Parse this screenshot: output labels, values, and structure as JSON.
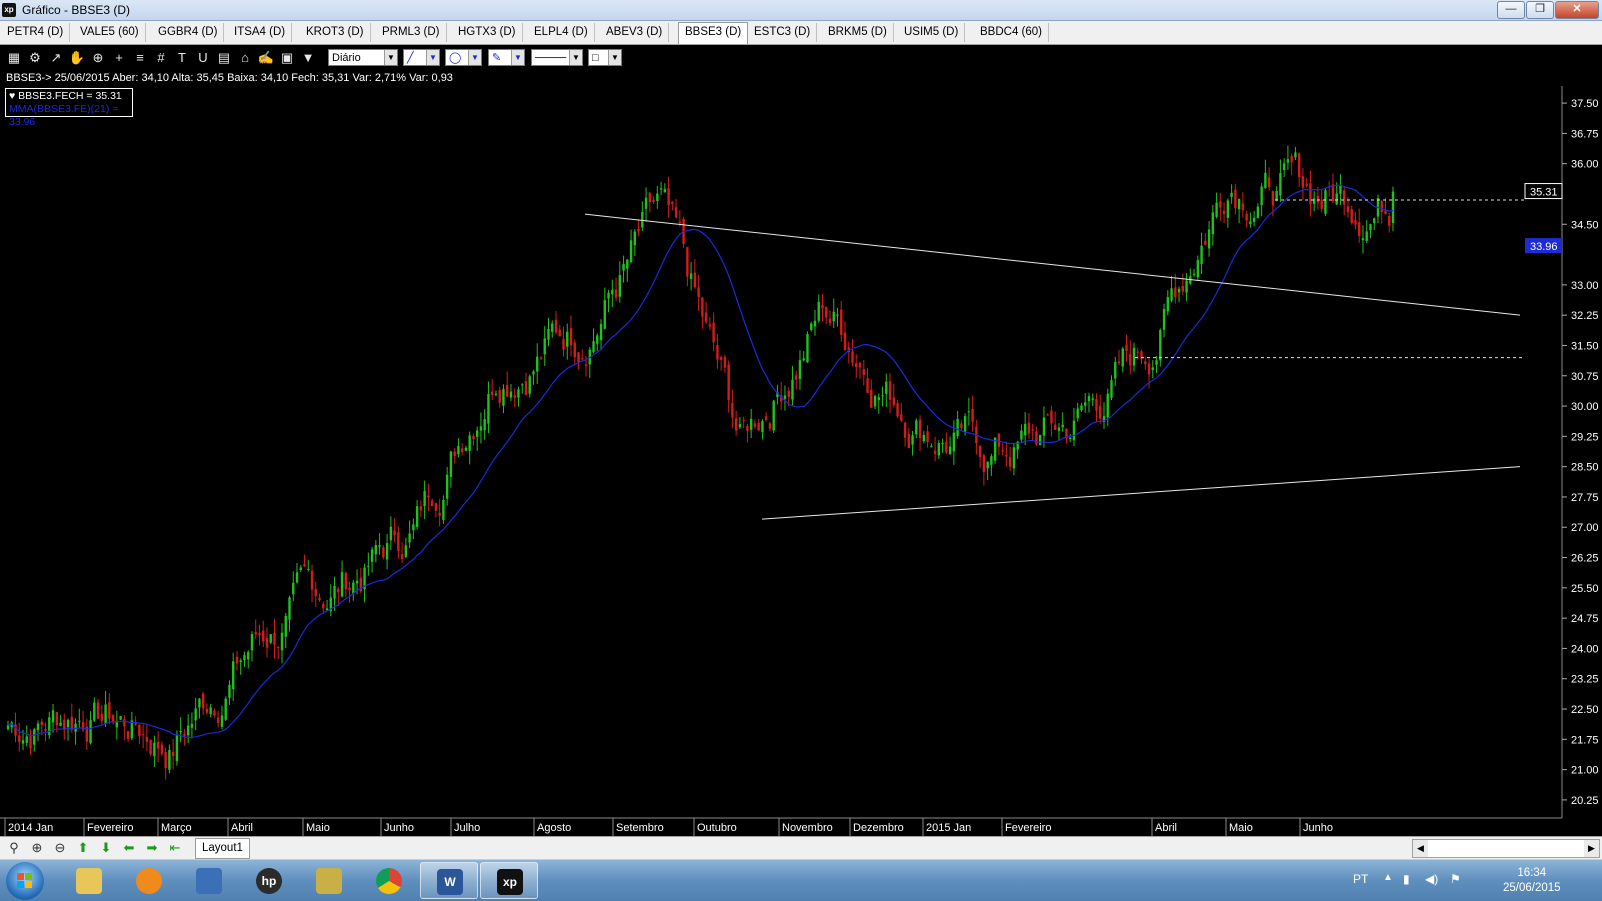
{
  "window": {
    "title": "Gráfico - BBSE3 (D)",
    "app_icon": "xp",
    "minimize_label": "—",
    "maximize_label": "❐",
    "close_label": "✕"
  },
  "tabs": [
    {
      "label": "PETR4 (D)",
      "active": false
    },
    {
      "label": "VALE5 (60)",
      "active": false
    },
    {
      "label": "GGBR4 (D)",
      "active": false
    },
    {
      "label": "ITSA4 (D)",
      "active": false
    },
    {
      "label": "KROT3 (D)",
      "active": false
    },
    {
      "label": "PRML3 (D)",
      "active": false
    },
    {
      "label": "HGTX3 (D)",
      "active": false
    },
    {
      "label": "ELPL4 (D)",
      "active": false
    },
    {
      "label": "ABEV3 (D)",
      "active": false
    },
    {
      "label": "BBSE3 (D)",
      "active": true
    },
    {
      "label": "ESTC3 (D)",
      "active": false
    },
    {
      "label": "BRKM5 (D)",
      "active": false
    },
    {
      "label": "USIM5 (D)",
      "active": false
    },
    {
      "label": "BBDC4 (60)",
      "active": false
    }
  ],
  "toolbar": {
    "icons": [
      "chart-icon",
      "gear-icon",
      "line-tool-icon",
      "hand-icon",
      "crosshair-cursor-icon",
      "plus-cursor-icon",
      "fibonacci-icon",
      "grid-icon",
      "text-icon",
      "magnet-icon",
      "calculator-icon",
      "u-icon",
      "brush-icon",
      "lock-icon",
      "filter-icon"
    ],
    "period_value": "Diário",
    "line_style_label": "╱",
    "ellipse_label": "◯",
    "pen_label": "✎",
    "line_width_label": "────",
    "color_label": "□"
  },
  "info_bar": "BBSE3-> 25/06/2015 Aber: 34,10 Alta: 35,45 Baixa: 34,10 Fech: 35,31 Var: 2,71% Var: 0,93",
  "legend": {
    "close_line": "♥ BBSE3.FECH = 35.31",
    "mma_line": "MMA(BBSE3.FE)(21) = 33.96"
  },
  "colors": {
    "background": "#000000",
    "up_candle": "#1fc21f",
    "down_candle": "#d41c1c",
    "mma": "#1c2ad8",
    "trendline": "#e8e8e8"
  },
  "chart_data": {
    "type": "candlestick",
    "symbol": "BBSE3",
    "period": "Diário",
    "ylim": [
      20.0,
      37.75
    ],
    "y_ticks": [
      "37.50",
      "36.75",
      "36.00",
      "34.50",
      "33.00",
      "32.25",
      "31.50",
      "30.75",
      "30.00",
      "29.25",
      "28.50",
      "27.75",
      "27.00",
      "26.25",
      "25.50",
      "24.75",
      "24.00",
      "23.25",
      "22.50",
      "21.75",
      "21.00",
      "20.25"
    ],
    "last_price_label": "35.31",
    "mma_price_label": "33.96",
    "x_labels": [
      "2014 Jan",
      "Fevereiro",
      "Março",
      "Abril",
      "Maio",
      "Junho",
      "Julho",
      "Agosto",
      "Setembro",
      "Outubro",
      "Novembro",
      "Dezembro",
      "2015 Jan",
      "Fevereiro",
      "Abril",
      "Maio",
      "Junho"
    ],
    "close_anchor_series": [
      {
        "month": "2014 Jan",
        "close": 22.1
      },
      {
        "month": "Fevereiro",
        "close": 22.6
      },
      {
        "month": "Março",
        "close": 21.7
      },
      {
        "month": "Abril",
        "close": 24.2
      },
      {
        "month": "Maio",
        "close": 25.4
      },
      {
        "month": "Junho",
        "close": 27.0
      },
      {
        "month": "Julho",
        "close": 31.4
      },
      {
        "month": "Agosto",
        "close": 32.0
      },
      {
        "month": "Setembro",
        "close": 34.6
      },
      {
        "month": "Outubro",
        "close": 28.9
      },
      {
        "month": "Novembro",
        "close": 32.5
      },
      {
        "month": "Dezembro",
        "close": 30.2
      },
      {
        "month": "2015 Jan",
        "close": 28.8
      },
      {
        "month": "Fevereiro",
        "close": 29.4
      },
      {
        "month": "Março",
        "close": 31.4
      },
      {
        "month": "Abril",
        "close": 36.0
      },
      {
        "month": "Maio",
        "close": 35.2
      },
      {
        "month": "Junho",
        "close": 35.31
      }
    ],
    "reference_lines": [
      {
        "name": "resistance-trendline",
        "from": {
          "date": "2014-09",
          "price": 34.75
        },
        "to": {
          "date": "2015-07",
          "price": 32.25
        }
      },
      {
        "name": "support-trendline",
        "from": {
          "date": "2014-10",
          "price": 27.2
        },
        "to": {
          "date": "2015-07",
          "price": 28.5
        }
      },
      {
        "name": "dashed-upper",
        "price": 35.1
      },
      {
        "name": "dashed-lower",
        "price": 31.2
      }
    ]
  },
  "bottom_bar": {
    "layout_tab": "Layout1",
    "icons": [
      "zoom-icon",
      "zoom-in-icon",
      "zoom-out-icon",
      "arrow-up-icon",
      "arrow-down-icon",
      "arrow-left-icon",
      "arrow-right-icon",
      "arrow-first-icon"
    ]
  },
  "taskbar": {
    "apps": [
      "explorer",
      "media-player",
      "network",
      "hp",
      "tools",
      "chrome",
      "word",
      "xp"
    ],
    "language": "PT",
    "time": "16:34",
    "date": "25/06/2015"
  }
}
